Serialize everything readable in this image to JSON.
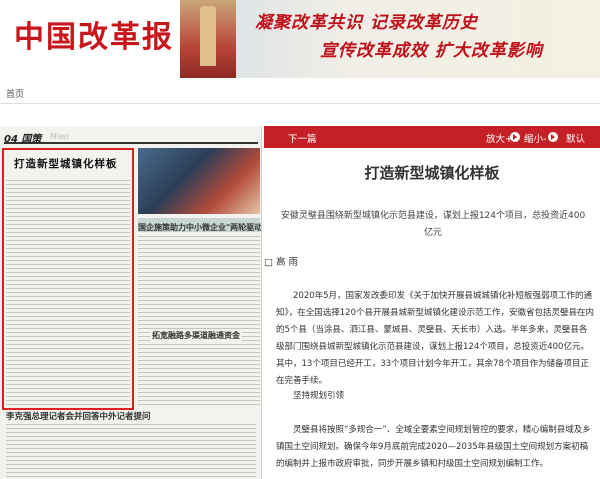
{
  "banner": {
    "logo": "中国改革报",
    "slogan_line1": "凝聚改革共识  记录改革历史",
    "slogan_line2": "宣传改革成效  扩大改革影响"
  },
  "nav": {
    "home": "首页"
  },
  "paper": {
    "page_no": "04 国策",
    "page_mark": "Mien",
    "highlighted_title": "打造新型城镇化样板",
    "sub_head_1": "国企施策助力中小微企业\"两轮驱动\"",
    "sub_head_2": "拓宽融路多渠道融通资金",
    "bottom_head": "李克强总理记者会并回答中外记者提问"
  },
  "toolbar": {
    "prev_label": "下一篇",
    "zoom_in": "放大+",
    "zoom_out": "缩小-",
    "reset": "默认"
  },
  "article": {
    "title": "打造新型城镇化样板",
    "summary": "安徽灵璧县围绕新型城镇化示范县建设，谋划上报124个项目，总投资近400亿元",
    "author": "□ 高 雨",
    "paragraphs": [
      "2020年5月，国家发改委印发《关于加快开展县城城镇化补短板强弱项工作的通知》，在全国选择120个县开展县城新型城镇化建设示范工作，安徽省包括灵璧县在内的5个县（当涂县、泗江县、蒙城县、灵璧县、天长市）入选。半年多来，灵璧县各级部门围绕县城新型城镇化示范县建设，谋划上报124个项目，总投资近400亿元。其中，13个项目已经开工，33个项目计划今年开工，其余78个项目作为储备项目正在完善手续。",
      "坚持规划引领",
      "灵璧县将按照“多规合一”、全域全要素空间规划管控的要求，精心编制县域及乡镇国土空间规划。确保今年9月底前完成2020—2035年县级国土空间规划方案初稿的编制并上报市政府审批，同步开展乡镇和村级国土空间规划编制工作。"
    ]
  }
}
